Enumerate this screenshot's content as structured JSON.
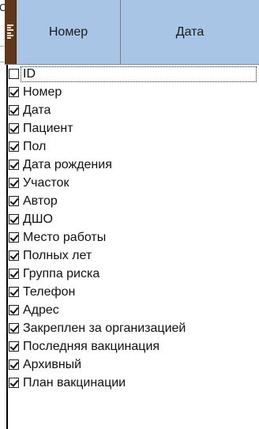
{
  "header": {
    "columns": [
      {
        "label": "Номер"
      },
      {
        "label": "Дата"
      }
    ],
    "colors": {
      "header_bg": "#a8c5e6",
      "chooser_bg": "#5e3818"
    },
    "chooser_icon": "column-chooser-icon"
  },
  "stray_glyph": "С",
  "column_chooser": {
    "items": [
      {
        "label": "ID",
        "checked": false,
        "focused": true
      },
      {
        "label": "Номер",
        "checked": true
      },
      {
        "label": "Дата",
        "checked": true
      },
      {
        "label": "Пациент",
        "checked": true
      },
      {
        "label": "Пол",
        "checked": true
      },
      {
        "label": "Дата рождения",
        "checked": true
      },
      {
        "label": "Участок",
        "checked": true
      },
      {
        "label": "Автор",
        "checked": true
      },
      {
        "label": "ДШО",
        "checked": true
      },
      {
        "label": "Место работы",
        "checked": true
      },
      {
        "label": "Полных лет",
        "checked": true
      },
      {
        "label": "Группа риска",
        "checked": true
      },
      {
        "label": "Телефон",
        "checked": true
      },
      {
        "label": "Адрес",
        "checked": true
      },
      {
        "label": "Закреплен за организацией",
        "checked": true
      },
      {
        "label": "Последняя вакцинация",
        "checked": true
      },
      {
        "label": "Архивный",
        "checked": true
      },
      {
        "label": "План вакцинации",
        "checked": true
      }
    ]
  }
}
